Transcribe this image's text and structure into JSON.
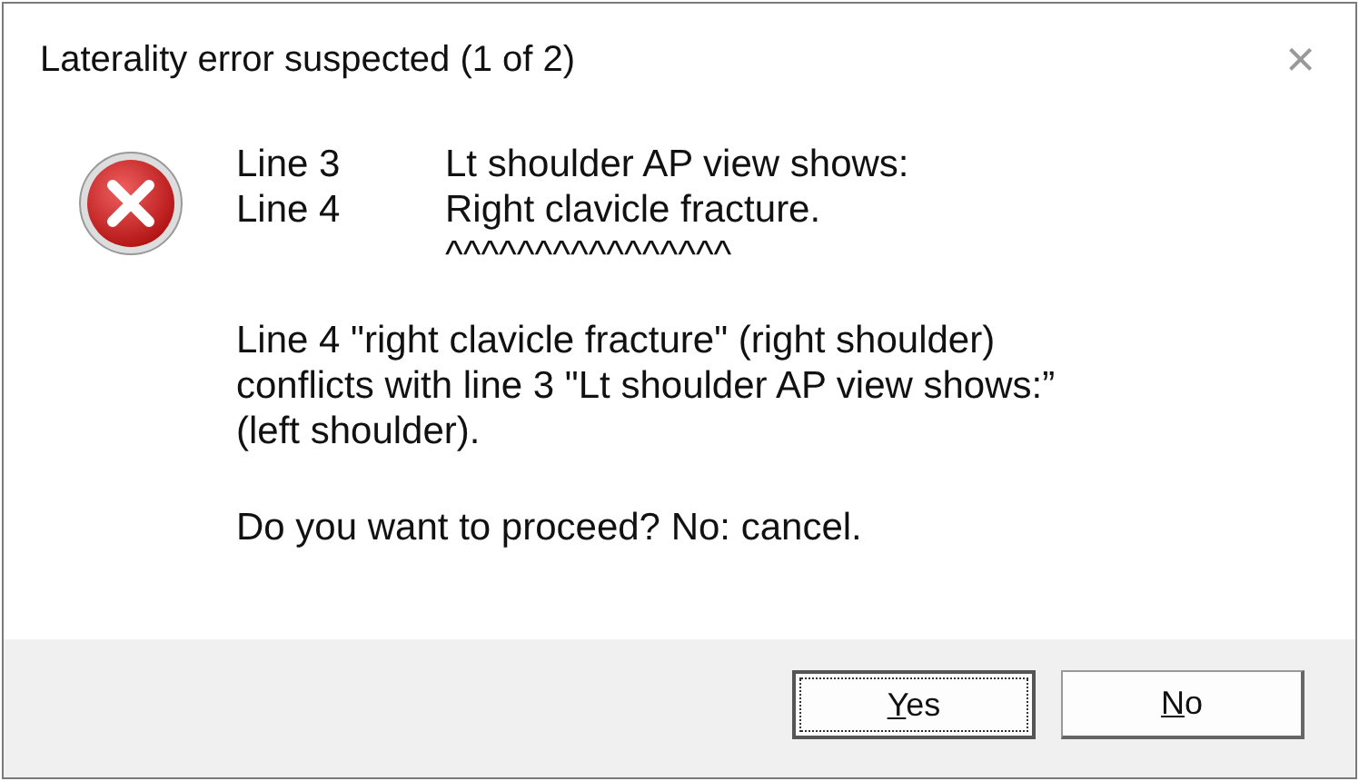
{
  "window": {
    "title": "Laterality error suspected (1 of 2)",
    "close": "×"
  },
  "lines": [
    {
      "label": "Line 3",
      "text": "Lt shoulder AP view shows:"
    },
    {
      "label": "Line 4",
      "text": "Right clavicle fracture."
    },
    {
      "text": "^^^^^^^^^^^^^^^^"
    }
  ],
  "message": "Line 4 \"right clavicle fracture\" (right shoulder) conflicts with line 3 \"Lt shoulder AP view shows:” (left shoulder).",
  "question": "Do you want to proceed? No: cancel.",
  "buttons": [
    {
      "label": "Yes",
      "focused": true
    },
    {
      "label": "No",
      "focused": false
    }
  ]
}
